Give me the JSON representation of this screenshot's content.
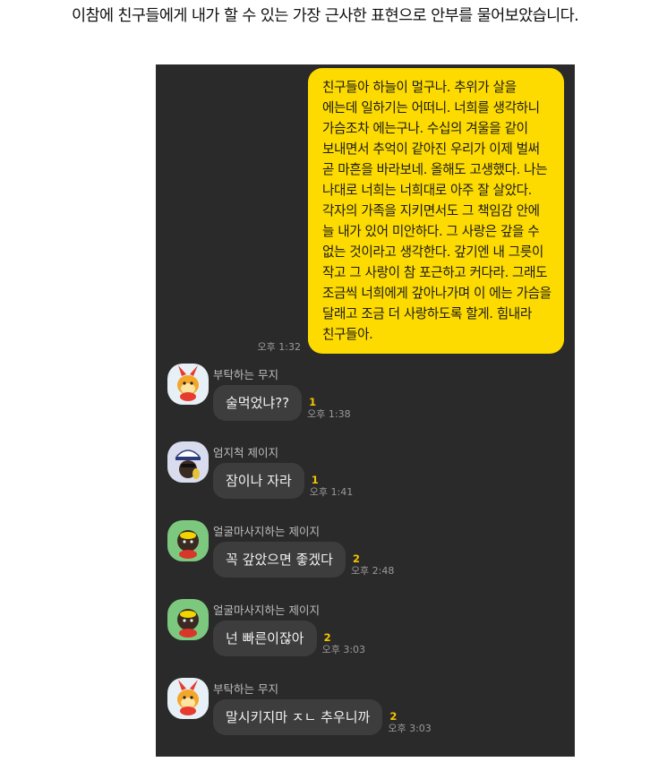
{
  "caption": "이참에 친구들에게 내가 할 수 있는 가장 근사한 표현으로 안부를 물어보았습니다.",
  "sent_message": {
    "text": "친구들아 하늘이 멀구나. 추위가 살을 에는데 일하기는 어떠니. 너희를 생각하니 가슴조차 에는구나. 수십의 겨울을 같이 보내면서 추억이 같아진 우리가 이제 벌써 곧 마흔을 바라보네. 올해도 고생했다. 나는 나대로 너희는 너희대로 아주 잘 살았다. 각자의 가족을 지키면서도 그 책임감 안에 늘 내가 있어 미안하다. 그 사랑은 갚을 수 없는 것이라고 생각한다. 갚기엔 내 그릇이 작고 그 사랑이 참 포근하고 커다라. 그래도 조금씩 너희에게 갚아나가며 이 에는 가슴을 달래고 조금 더 사랑하도록 할게. 힘내라 친구들아.",
    "time": "오후 1:32"
  },
  "messages": [
    {
      "sender": "부탁하는 무지",
      "avatar": "muzi-avatar-icon",
      "text": "술먹었냐??",
      "unread": "1",
      "time": "오후 1:38"
    },
    {
      "sender": "엄지척 제이지",
      "avatar": "jayg-thumbs-up-avatar-icon",
      "text": "잠이나 자라",
      "unread": "1",
      "time": "오후 1:41"
    },
    {
      "sender": "얼굴마사지하는 제이지",
      "avatar": "jayg-face-massage-avatar-icon",
      "text": "꼭 갚았으면 좋겠다",
      "unread": "2",
      "time": "오후 2:48"
    },
    {
      "sender": "얼굴마사지하는 제이지",
      "avatar": "jayg-face-massage-avatar-icon",
      "text": "넌 빠른이잖아",
      "unread": "2",
      "time": "오후 3:03"
    },
    {
      "sender": "부탁하는 무지",
      "avatar": "muzi-avatar-icon",
      "text": "말시키지마 ㅈㄴ 추우니까",
      "unread": "2",
      "time": "오후 3:03"
    }
  ],
  "colors": {
    "chat_background": "#2a2a2a",
    "sent_bubble": "#fddb00",
    "received_bubble": "#3d3d3d",
    "unread_count": "#f5c400",
    "muzi_avatar_bg": "#e6f0f6",
    "jayg_thumbs_avatar_bg": "#d8dcec",
    "jayg_massage_avatar_bg": "#7dc87f"
  }
}
